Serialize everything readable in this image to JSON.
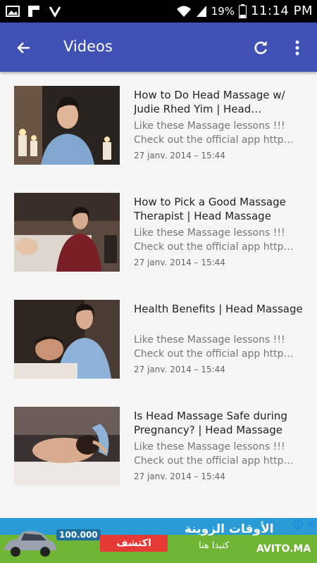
{
  "status_bar": {
    "battery_percent": "19%",
    "time": "11:14 PM",
    "left_icons": [
      "gallery-icon",
      "flipboard-icon",
      "check-icon"
    ],
    "right_icons": [
      "wifi-icon",
      "signal-icon",
      "battery-icon"
    ]
  },
  "app_bar": {
    "title": "Videos",
    "color": "#3f51b5"
  },
  "videos": [
    {
      "title": "How to Do Head Massage w/ Judie Rhed Yim | Head…",
      "desc1": "Like these Massage lessons !!!",
      "desc2": "Check out the official app http…",
      "date": "27 janv. 2014 – 15:44"
    },
    {
      "title": "How to Pick a Good Massage Therapist | Head Massage",
      "desc1": "Like these Massage lessons !!!",
      "desc2": "Check out the official app http…",
      "date": "27 janv. 2014 – 15:44"
    },
    {
      "title": "Health Benefits | Head Massage",
      "desc1": "Like these Massage lessons !!!",
      "desc2": "Check out the official app http…",
      "date": "27 janv. 2014 – 15:44"
    },
    {
      "title": "Is Head Massage Safe during Pregnancy? | Head Massage",
      "desc1": "Like these Massage lessons !!!",
      "desc2": "Check out the official app http…",
      "date": "27 janv. 2014 – 15:44"
    }
  ],
  "ad": {
    "headline": "الأوقات الزوينة",
    "sub": "كتبدا هنا",
    "button": "اكتشف",
    "price": "100.000",
    "logo": "AVITO.MA"
  }
}
